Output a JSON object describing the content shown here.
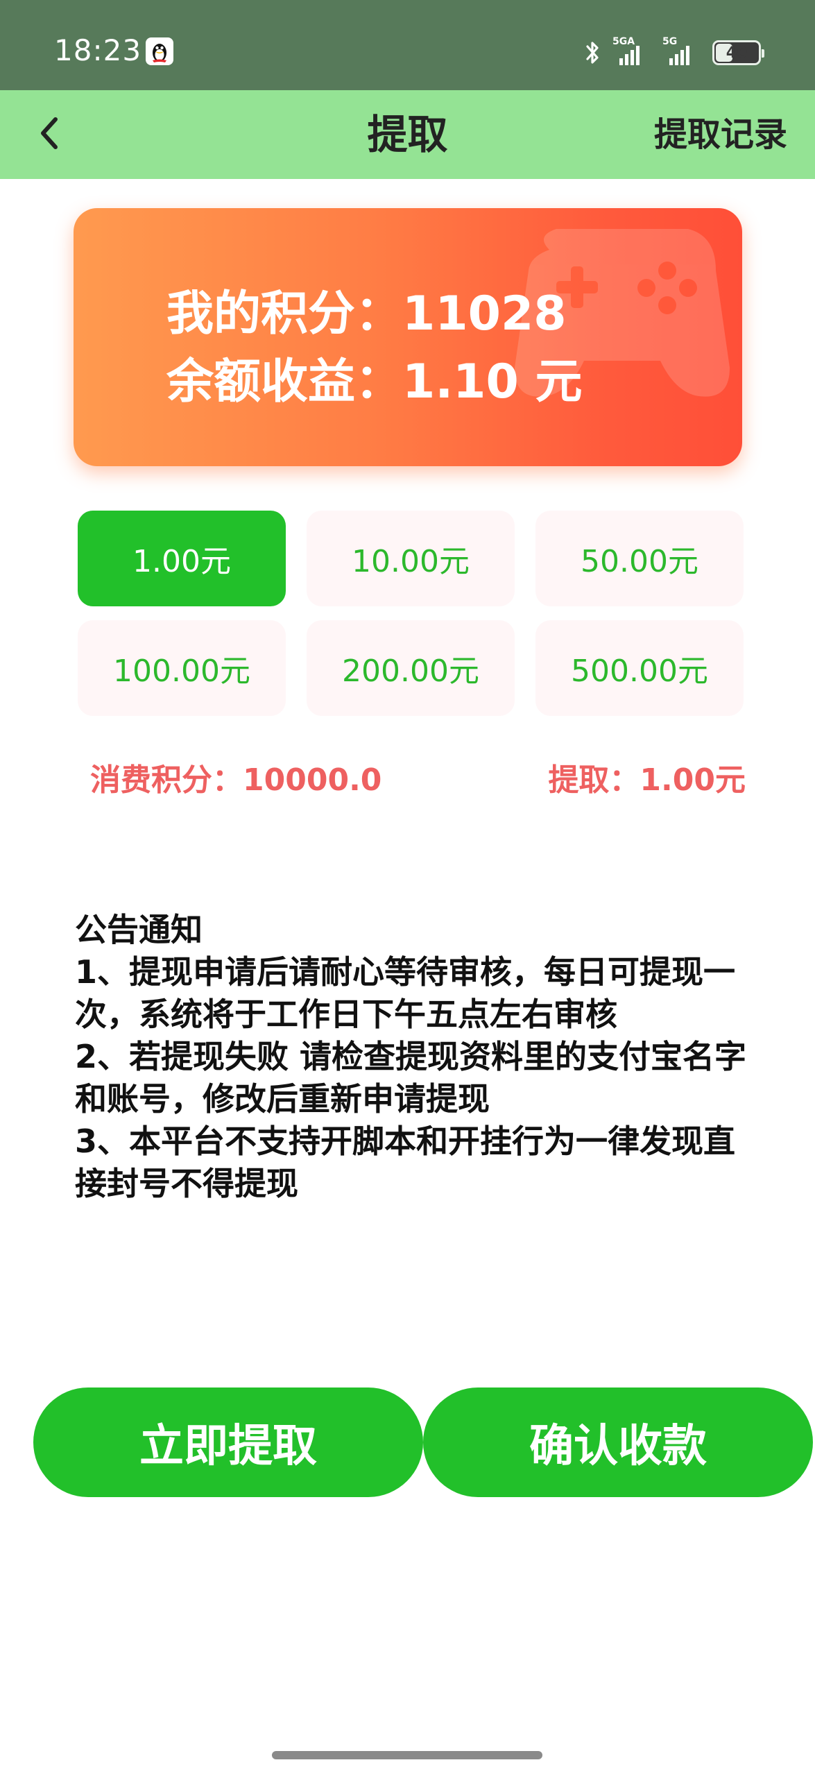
{
  "status_bar": {
    "time": "18:23",
    "app_icon": "qq-penguin-icon",
    "bluetooth_icon": "bluetooth-icon",
    "signal_1_label": "5GA",
    "signal_2_label": "5G",
    "battery_level": "40",
    "battery_fraction": 0.4
  },
  "header": {
    "back_icon": "chevron-left-icon",
    "title": "提取",
    "records_link": "提取记录"
  },
  "points_card": {
    "points_line": "我的积分：11028",
    "balance_line": "余额收益：1.10 元",
    "decoration_icon": "gamepad-icon"
  },
  "amount_options": [
    {
      "label": "1.00元",
      "selected": true
    },
    {
      "label": "10.00元",
      "selected": false
    },
    {
      "label": "50.00元",
      "selected": false
    },
    {
      "label": "100.00元",
      "selected": false
    },
    {
      "label": "200.00元",
      "selected": false
    },
    {
      "label": "500.00元",
      "selected": false
    }
  ],
  "summary": {
    "cost": "消费积分：10000.0",
    "withdraw": "提取：1.00元"
  },
  "notice": {
    "title": "公告通知",
    "item1": "1、提现申请后请耐心等待审核，每日可提现一次，系统将于工作日下午五点左右审核",
    "item2": "2、若提现失败 请检查提现资料里的支付宝名字和账号，修改后重新申请提现",
    "item3": "3、本平台不支持开脚本和开挂行为一律发现直接封号不得提现"
  },
  "actions": {
    "withdraw_now": "立即提取",
    "confirm_receipt": "确认收款"
  },
  "colors": {
    "status_bar_bg": "#577a5a",
    "header_bg": "#94e394",
    "accent_green": "#22c02a",
    "option_text_green": "#2cb82c",
    "card_gradient_start": "#ff9a4f",
    "card_gradient_end": "#ff4f38",
    "summary_red": "#ee6060"
  }
}
